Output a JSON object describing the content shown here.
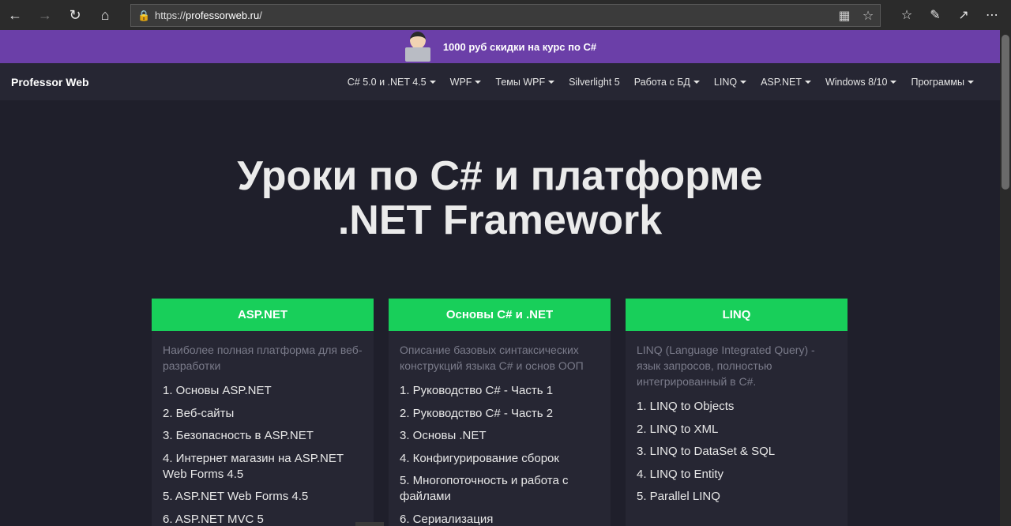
{
  "browser": {
    "url_prefix": "https://",
    "url_host": "professorweb.ru",
    "url_suffix": "/",
    "icons": [
      "back-icon",
      "forward-icon",
      "refresh-icon",
      "home-icon",
      "lock-icon",
      "reading-view-icon",
      "favorite-star-icon",
      "favorites-hub-icon",
      "pen-icon",
      "share-icon",
      "more-icon"
    ]
  },
  "promo": {
    "text": "1000 руб скидки на курс по C#"
  },
  "site": {
    "brand": "Professor Web",
    "menu": [
      {
        "label": "C# 5.0 и .NET 4.5",
        "dropdown": true
      },
      {
        "label": "WPF",
        "dropdown": true
      },
      {
        "label": "Темы WPF",
        "dropdown": true
      },
      {
        "label": "Silverlight 5",
        "dropdown": false
      },
      {
        "label": "Работа с БД",
        "dropdown": true
      },
      {
        "label": "LINQ",
        "dropdown": true
      },
      {
        "label": "ASP.NET",
        "dropdown": true
      },
      {
        "label": "Windows 8/10",
        "dropdown": true
      },
      {
        "label": "Программы",
        "dropdown": true
      }
    ]
  },
  "hero": {
    "line1": "Уроки по C# и платформе",
    "line2": ".NET Framework"
  },
  "cards": [
    {
      "title": "ASP.NET",
      "description": "Наиболее полная платформа для веб-разработки",
      "items": [
        "1. Основы ASP.NET",
        "2. Веб-сайты",
        "3. Безопасность в ASP.NET",
        "4. Интернет магазин на ASP.NET Web Forms 4.5",
        "5. ASP.NET Web Forms 4.5",
        "6. ASP.NET MVC 5"
      ]
    },
    {
      "title": "Основы C# и .NET",
      "description": "Описание базовых синтаксических конструкций языка C# и основ ООП",
      "items": [
        "1. Руководство C# - Часть 1",
        "2. Руководство C# - Часть 2",
        "3. Основы .NET",
        "4. Конфигурирование сборок",
        "5. Многопоточность и работа с файлами",
        "6. Сериализация"
      ]
    },
    {
      "title": "LINQ",
      "description": "LINQ (Language Integrated Query) - язык запросов, полностью интегрированный в C#.",
      "items": [
        "1. LINQ to Objects",
        "2. LINQ to XML",
        "3. LINQ to DataSet & SQL",
        "4. LINQ to Entity",
        "5. Parallel LINQ"
      ]
    }
  ]
}
